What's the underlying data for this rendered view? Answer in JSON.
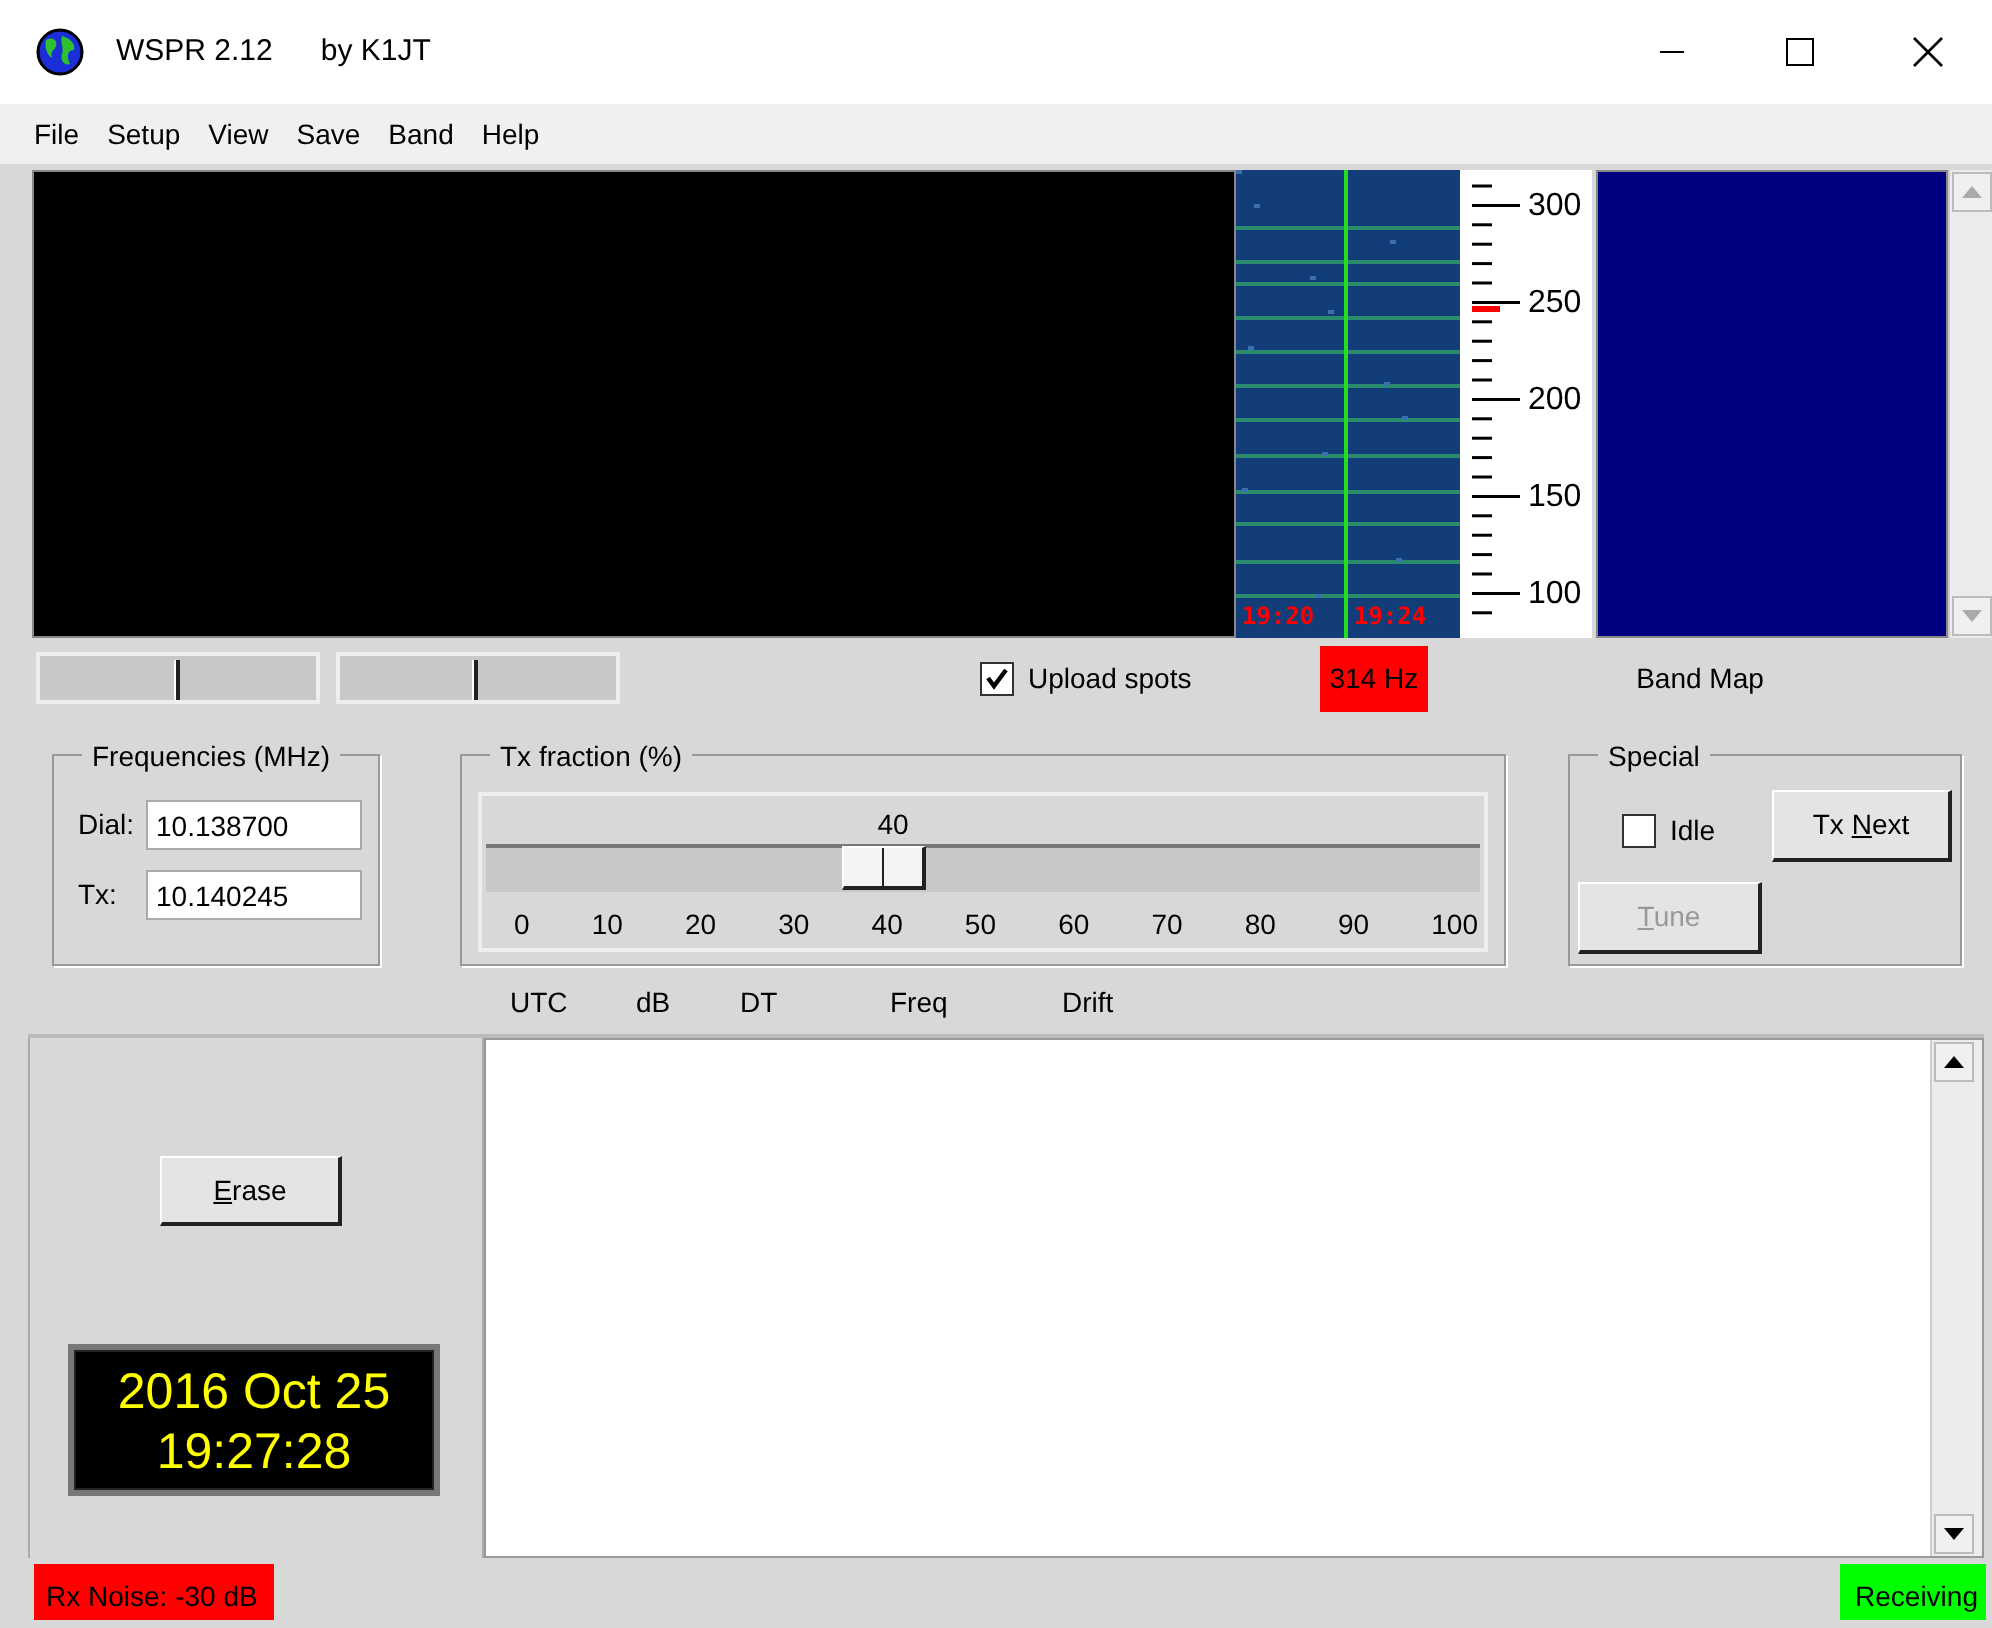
{
  "window": {
    "title": "WSPR 2.12",
    "subtitle": "by K1JT"
  },
  "menu": [
    "File",
    "Setup",
    "View",
    "Save",
    "Band",
    "Help"
  ],
  "waterfall": {
    "times": [
      "19:20",
      "19:24"
    ],
    "scale_labels": [
      "300",
      "250",
      "200",
      "150",
      "100"
    ]
  },
  "sliders": [
    {
      "level": 0.51
    },
    {
      "level": 0.5
    }
  ],
  "upload_spots": {
    "label": "Upload spots",
    "checked": true
  },
  "offset": {
    "text": "314 Hz"
  },
  "band_map": {
    "title": "Band Map"
  },
  "frequencies": {
    "title": "Frequencies (MHz)",
    "fields": [
      {
        "label": "Dial:",
        "value": "10.138700"
      },
      {
        "label": "Tx:",
        "value": "10.140245"
      }
    ]
  },
  "tx_fraction": {
    "title": "Tx fraction (%)",
    "reading": "40",
    "level": 0.4,
    "ticks": [
      "0",
      "10",
      "20",
      "30",
      "40",
      "50",
      "60",
      "70",
      "80",
      "90",
      "100"
    ]
  },
  "special": {
    "title": "Special",
    "idle": {
      "label": "Idle",
      "checked": false
    },
    "buttons": [
      {
        "label_parts": [
          {
            "text": "Tx "
          },
          {
            "text": "N",
            "underlined": true
          },
          {
            "text": "ext"
          }
        ],
        "disabled": false
      },
      {
        "label_parts": [
          {
            "text": "T",
            "underlined": true
          },
          {
            "text": "une"
          }
        ],
        "disabled": true
      }
    ]
  },
  "decodes": {
    "columns": [
      "UTC",
      "dB",
      "DT",
      "Freq",
      "Drift"
    ]
  },
  "erase": {
    "label_parts": [
      {
        "text": "E",
        "underlined": true
      },
      {
        "text": "rase"
      }
    ]
  },
  "clock": {
    "date": "2016 Oct 25",
    "time": "19:27:28"
  },
  "status_bar": {
    "noise": "Rx Noise: -30  dB",
    "state": "Receiving"
  }
}
